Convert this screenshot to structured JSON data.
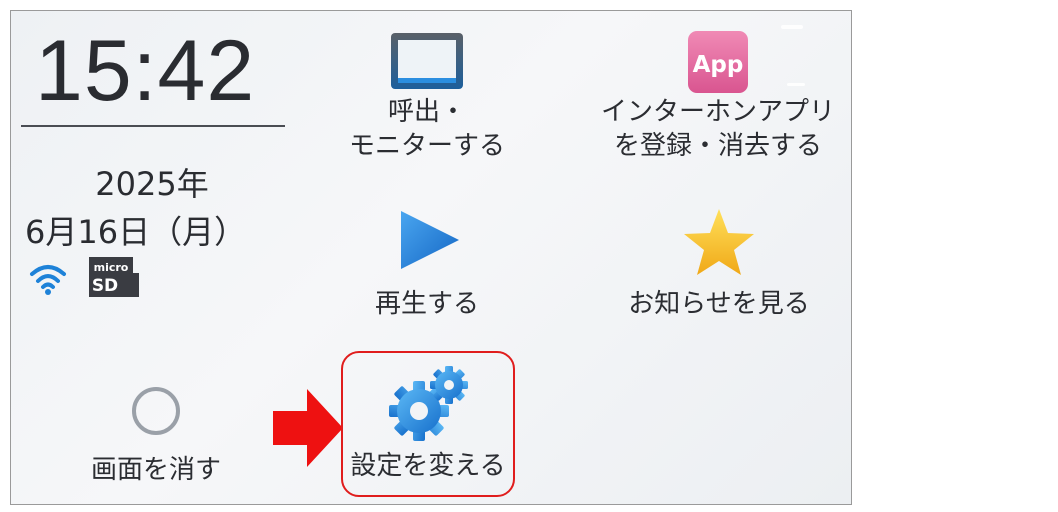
{
  "status": {
    "time": "15:42",
    "date_year": "2025年",
    "date_day": "6月16日（月）",
    "sd_label_top": "micro",
    "sd_label_bottom": "SD",
    "wifi_icon": "wifi-icon",
    "sd_icon": "microsd-icon"
  },
  "menu": {
    "monitor": {
      "line1": "呼出・",
      "line2": "モニターする",
      "icon": "monitor-icon"
    },
    "app": {
      "line1": "インターホンアプリ",
      "line2": "を登録・消去する",
      "icon": "app-icon",
      "icon_text": "App"
    },
    "play": {
      "label": "再生する",
      "icon": "play-icon"
    },
    "news": {
      "label": "お知らせを見る",
      "icon": "star-icon"
    },
    "screen_off": {
      "label": "画面を消す",
      "icon": "circle-icon"
    },
    "settings": {
      "label": "設定を変える",
      "icon": "gear-icon"
    }
  },
  "colors": {
    "highlight": "#e01d1d",
    "arrow": "#ee1111",
    "accent_blue": "#1e82d8",
    "app_pink": "#e46ea0",
    "star_yellow": "#f5c51e"
  }
}
